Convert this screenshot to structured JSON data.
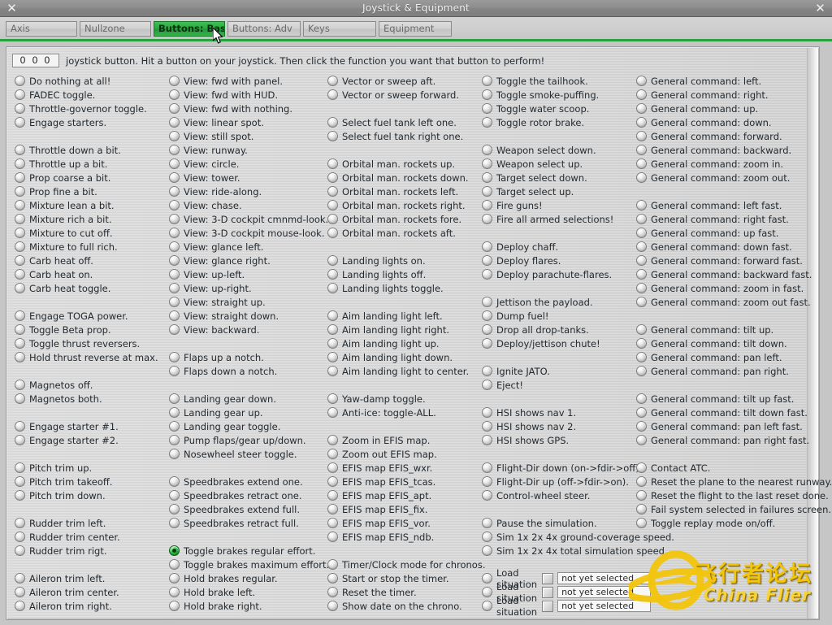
{
  "window": {
    "title": "Joystick & Equipment",
    "close_icon_left": "✕",
    "close_icon_right": "✕"
  },
  "tabs": [
    {
      "label": "Axis",
      "active": false
    },
    {
      "label": "Nullzone",
      "active": false
    },
    {
      "label": "Buttons: Basic",
      "active": true
    },
    {
      "label": "Buttons: Adv",
      "active": false
    },
    {
      "label": "Keys",
      "active": false
    },
    {
      "label": "Equipment",
      "active": false
    }
  ],
  "header": {
    "button_id": "0 0 0",
    "instruction": "joystick button. Hit a button on your joystick. Then click the function you want that button to perform!"
  },
  "columns": [
    {
      "name": "column-1",
      "groups": [
        {
          "items": [
            "Do nothing at all!",
            "FADEC toggle.",
            "Throttle-governor toggle.",
            "Engage starters."
          ]
        },
        {
          "items": [
            "Throttle down a bit.",
            "Throttle up a bit.",
            "Prop coarse a bit.",
            "Prop fine a bit.",
            "Mixture lean a bit.",
            "Mixture rich a bit.",
            "Mixture to cut off.",
            "Mixture to full rich.",
            "Carb heat off.",
            "Carb heat on.",
            "Carb heat toggle."
          ]
        },
        {
          "items": [
            "Engage TOGA power.",
            "Toggle Beta prop.",
            "Toggle thrust reversers.",
            "Hold thrust reverse at max."
          ]
        },
        {
          "items": [
            "Magnetos off.",
            "Magnetos both."
          ]
        },
        {
          "items": [
            "Engage starter #1.",
            "Engage starter #2."
          ]
        },
        {
          "items": [
            "Pitch trim up.",
            "Pitch trim takeoff.",
            "Pitch trim down."
          ]
        },
        {
          "items": [
            "Rudder trim left.",
            "Rudder trim center.",
            "Rudder trim rigt."
          ]
        },
        {
          "items": [
            "Aileron trim left.",
            "Aileron trim center.",
            "Aileron trim right."
          ]
        }
      ]
    },
    {
      "name": "column-2",
      "groups": [
        {
          "items": [
            "View: fwd with panel.",
            "View: fwd with HUD.",
            "View: fwd with nothing.",
            "View: linear spot.",
            "View: still spot.",
            "View: runway.",
            "View: circle.",
            "View: tower.",
            "View: ride-along.",
            "View: chase.",
            "View: 3-D cockpit cmnmd-look.",
            "View: 3-D cockpit mouse-look.",
            "View: glance left.",
            "View: glance right.",
            "View: up-left.",
            "View: up-right.",
            "View: straight up."
          ]
        },
        {
          "items": [
            "View: straight down.",
            "View: backward."
          ],
          "nogap": true
        },
        {
          "items": [
            "Flaps up a notch.",
            "Flaps down a notch."
          ]
        },
        {
          "items": [
            "Landing gear down.",
            "Landing gear up.",
            "Landing gear toggle.",
            "Pump flaps/gear up/down.",
            "Nosewheel steer toggle."
          ]
        },
        {
          "items": [
            "Speedbrakes extend one.",
            "Speedbrakes retract one.",
            "Speedbrakes extend full.",
            "Speedbrakes retract full."
          ]
        },
        {
          "items": [
            "Toggle brakes regular effort.",
            "Toggle brakes maximum effort.",
            "Hold brakes regular.",
            "Hold brake left.",
            "Hold brake right."
          ]
        }
      ],
      "selected": "Toggle brakes regular effort."
    },
    {
      "name": "column-3",
      "groups": [
        {
          "items": [
            "Vector or sweep aft.",
            "Vector or sweep forward."
          ]
        },
        {
          "items": [
            "Select fuel tank left one.",
            "Select fuel tank right one."
          ]
        },
        {
          "items": [
            "Orbital man. rockets up.",
            "Orbital man. rockets down.",
            "Orbital man. rockets left.",
            "Orbital man. rockets right.",
            "Orbital man. rockets fore.",
            "Orbital man. rockets aft."
          ]
        },
        {
          "items": [
            "Landing lights on.",
            "Landing lights off.",
            "Landing lights toggle."
          ]
        },
        {
          "items": [
            "Aim landing light left.",
            "Aim landing light right.",
            "Aim landing light up.",
            "Aim landing light down.",
            "Aim landing light to center."
          ]
        },
        {
          "items": [
            "Yaw-damp toggle.",
            "Anti-ice: toggle-ALL."
          ]
        },
        {
          "items": [
            "Zoom in EFIS map.",
            "Zoom out EFIS map.",
            "EFIS map EFIS_wxr.",
            "EFIS map EFIS_tcas.",
            "EFIS map EFIS_apt.",
            "EFIS map EFIS_fix.",
            "EFIS map EFIS_vor.",
            "EFIS map EFIS_ndb."
          ]
        },
        {
          "items": [
            "Timer/Clock mode for chronos.",
            "Start or stop the timer.",
            "Reset the timer.",
            "Show date on the chrono."
          ]
        }
      ]
    },
    {
      "name": "column-4",
      "groups": [
        {
          "items": [
            "Toggle the tailhook.",
            "Toggle smoke-puffing.",
            "Toggle water scoop.",
            "Toggle rotor brake."
          ]
        },
        {
          "items": [
            "Weapon select down.",
            "Weapon select up.",
            "Target select down.",
            "Target select up.",
            "Fire guns!",
            "Fire all armed selections!"
          ]
        },
        {
          "items": [
            "Deploy chaff.",
            "Deploy flares.",
            "Deploy parachute-flares."
          ]
        },
        {
          "items": [
            "Jettison the payload.",
            "Dump fuel!",
            "Drop all drop-tanks.",
            "Deploy/jettison chute!"
          ]
        },
        {
          "items": [
            "Ignite JATO.",
            "Eject!"
          ]
        },
        {
          "items": [
            "HSI shows nav 1.",
            "HSI shows nav 2.",
            "HSI shows GPS."
          ]
        },
        {
          "items": [
            "Flight-Dir down (on->fdir->off).",
            "Flight-Dir up (off->fdir->on).",
            "Control-wheel steer."
          ]
        },
        {
          "items": [
            "Pause the simulation.",
            "Sim 1x 2x 4x ground-coverage speed.",
            "Sim 1x 2x 4x total simulation speed."
          ]
        }
      ],
      "load_situations": {
        "label": "Load situation",
        "rows": [
          {
            "value": "not yet selected",
            "checked": false
          },
          {
            "value": "not yet selected",
            "checked": false
          },
          {
            "value": "not yet selected",
            "checked": false
          }
        ]
      }
    },
    {
      "name": "column-5",
      "groups": [
        {
          "items": [
            "General command: left.",
            "General command: right.",
            "General command: up.",
            "General command: down.",
            "General command: forward.",
            "General command: backward.",
            "General command: zoom in.",
            "General command: zoom out."
          ]
        },
        {
          "items": [
            "General command: left fast.",
            "General command: right fast.",
            "General command: up fast.",
            "General command: down fast.",
            "General command: forward fast.",
            "General command: backward fast.",
            "General command: zoom in fast.",
            "General command: zoom out fast."
          ]
        },
        {
          "items": [
            "General command: tilt up.",
            "General command: tilt down.",
            "General command: pan left.",
            "General command: pan right."
          ]
        },
        {
          "items": [
            "General command: tilt up fast.",
            "General command: tilt down fast.",
            "General command: pan left fast.",
            "General command: pan right fast."
          ]
        },
        {
          "items": [
            "Contact ATC.",
            "Reset the plane to the nearest runway.",
            "Reset the flight to the last reset done.",
            "Fail system selected in failures screen.",
            "Toggle replay mode on/off."
          ]
        }
      ]
    }
  ],
  "watermark": {
    "chinese": "飞行者论坛",
    "english": "China Flier"
  },
  "colors": {
    "accent_green": "#2aa13f",
    "selected_radio": "#1f9e33",
    "watermark_yellow": "#f2c40c",
    "panel_bg": "#d1d1d1",
    "titlebar": "#8e8e8e"
  }
}
